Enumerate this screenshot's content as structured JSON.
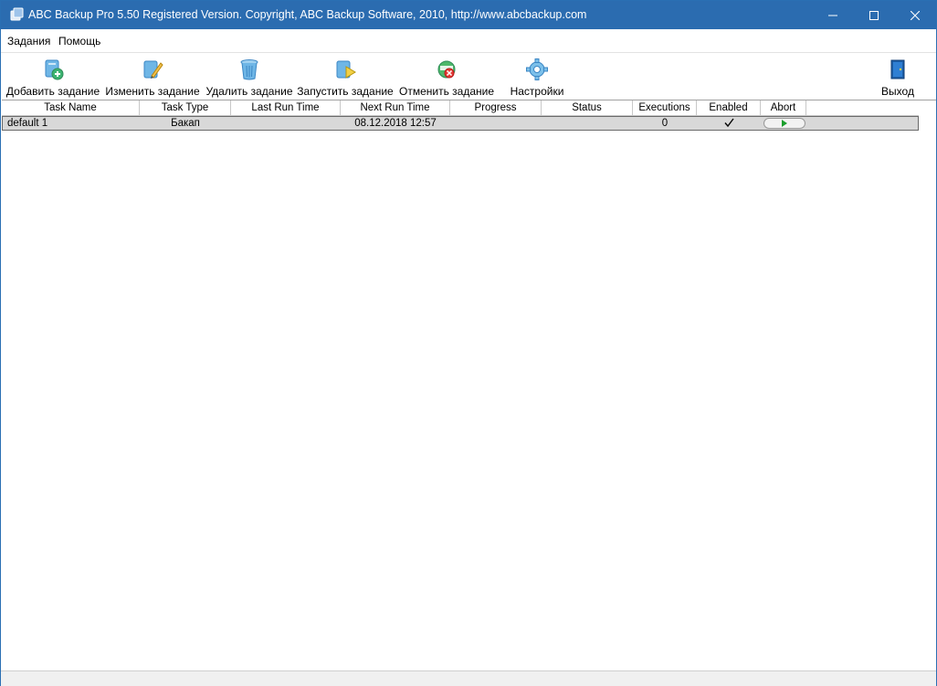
{
  "window": {
    "title": "ABC Backup Pro 5.50   Registered Version.  Copyright,  ABC Backup Software, 2010,   http://www.abcbackup.com",
    "controls": {
      "minimize": "minimize-icon",
      "maximize": "maximize-icon",
      "close": "close-icon"
    }
  },
  "menu": {
    "items": [
      {
        "label": "Задания"
      },
      {
        "label": "Помощь"
      }
    ]
  },
  "toolbar": {
    "buttons": [
      {
        "label": "Добавить задание",
        "icon": "add-task-icon"
      },
      {
        "label": "Изменить задание",
        "icon": "edit-task-icon"
      },
      {
        "label": "Удалить задание",
        "icon": "trash-icon"
      },
      {
        "label": "Запустить задание",
        "icon": "run-task-icon"
      },
      {
        "label": "Отменить задание",
        "icon": "cancel-task-icon"
      },
      {
        "label": "Настройки",
        "icon": "gear-icon"
      },
      {
        "label": "Выход",
        "icon": "exit-door-icon"
      }
    ]
  },
  "table": {
    "columns": [
      "Task Name",
      "Task Type",
      "Last Run Time",
      "Next Run Time",
      "Progress",
      "Status",
      "Executions",
      "Enabled",
      "Abort"
    ],
    "rows": [
      {
        "task_name": "default 1",
        "task_type": "Бакап",
        "last_run_time": "",
        "next_run_time": "08.12.2018 12:57",
        "progress": "",
        "status": "",
        "executions": "0",
        "enabled": true
      }
    ]
  },
  "colors": {
    "titlebar": "#2b6cb0",
    "selected_row": "#d8d8d8"
  }
}
